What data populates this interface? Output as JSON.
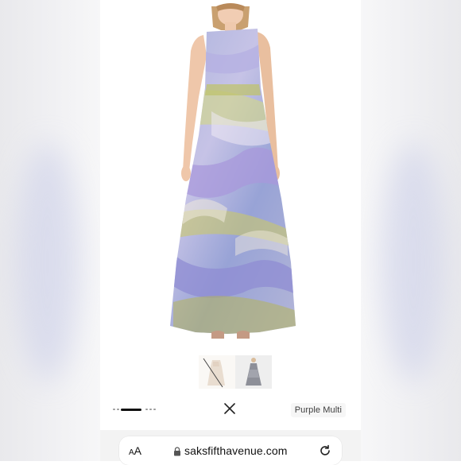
{
  "app": {
    "name": "Saks Fifth Avenue product page"
  },
  "product": {
    "image_alt": "Purple Multi one-shoulder floral jacquard gown",
    "color_label": "Purple Multi",
    "thumbnails": [
      {
        "id": "thumb-1",
        "selected": false
      },
      {
        "id": "thumb-2",
        "selected": true
      }
    ],
    "gallery_pages": 5,
    "gallery_current": 2
  },
  "controls": {
    "close_icon": "close-icon"
  },
  "browser": {
    "text_size_label": "AA",
    "url": "saksfifthavenue.com",
    "lock_icon": "lock-icon",
    "reload_icon": "reload-icon"
  },
  "colors": {
    "dress_blue": "#9aa6d8",
    "dress_lilac": "#b8a9e0",
    "dress_olive": "#b6b54a"
  }
}
